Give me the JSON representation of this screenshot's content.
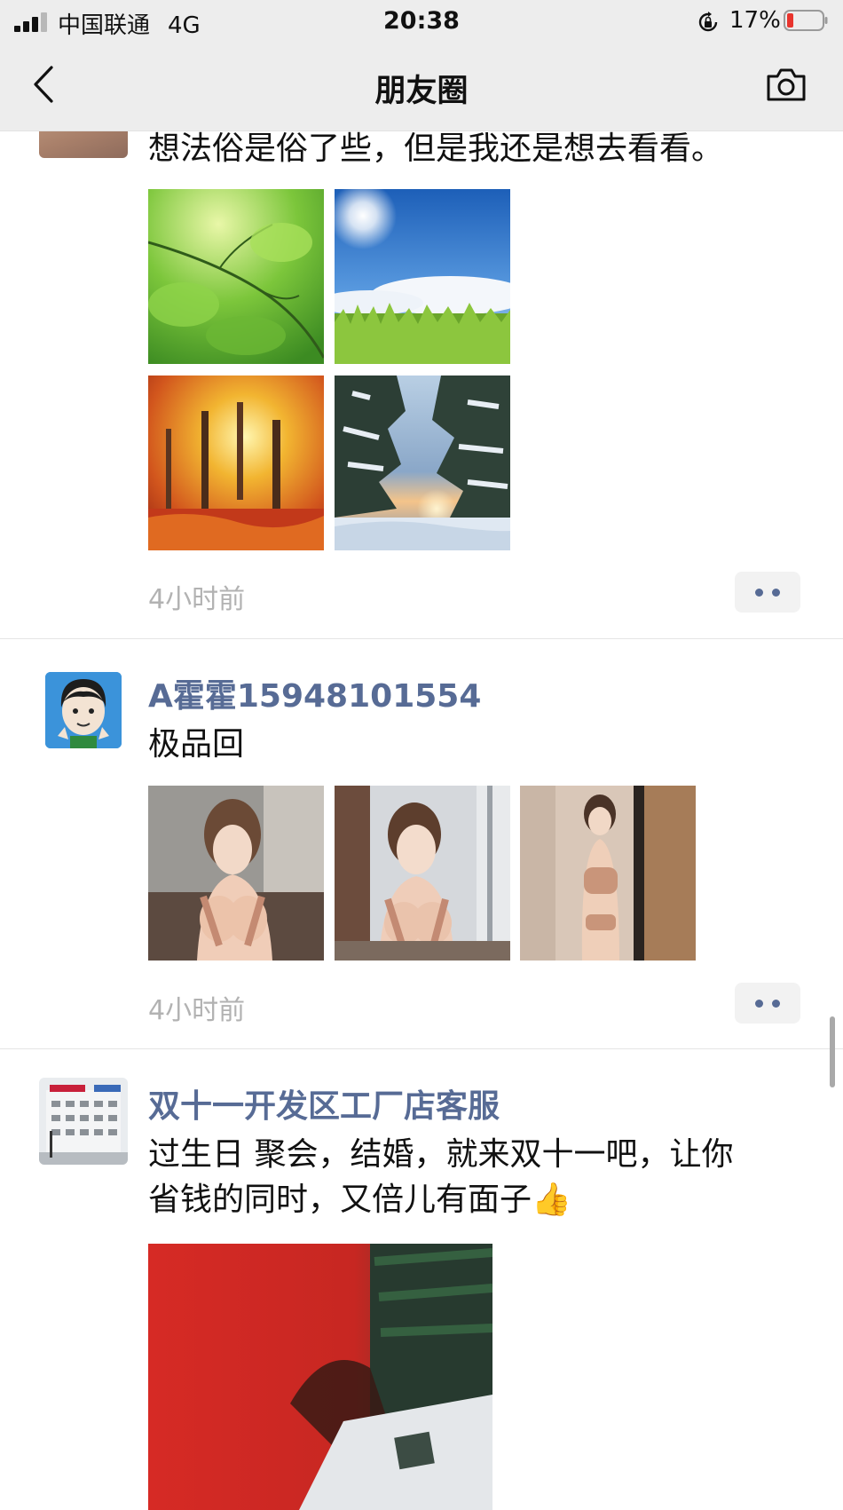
{
  "status_bar": {
    "carrier": "中国联通",
    "network": "4G",
    "time": "20:38",
    "battery": "17%"
  },
  "nav": {
    "title": "朋友圈",
    "back_icon": "chevron-left-icon",
    "camera_icon": "camera-icon"
  },
  "posts": [
    {
      "text": "想法俗是俗了些，但是我还是想去看看。",
      "images": [
        "green-leaves-photo",
        "sun-sky-grass-photo",
        "autumn-forest-photo",
        "snowy-forest-sunset-photo"
      ],
      "time": "4小时前"
    },
    {
      "author": "A霍霍15948101554",
      "text": "极品回",
      "images": [
        "woman-photo-1",
        "woman-photo-2",
        "woman-photo-3"
      ],
      "time": "4小时前"
    },
    {
      "author": "双十一开发区工厂店客服",
      "text_lines": [
        "过生日  聚会，结婚，就来双十一吧，让你",
        "省钱的同时，又倍儿有面子👍"
      ],
      "images": [
        "video-thumbnail"
      ]
    }
  ],
  "colors": {
    "author_name": "#576b95",
    "timestamp": "#b2b2b2",
    "nav_background": "#ededed"
  }
}
